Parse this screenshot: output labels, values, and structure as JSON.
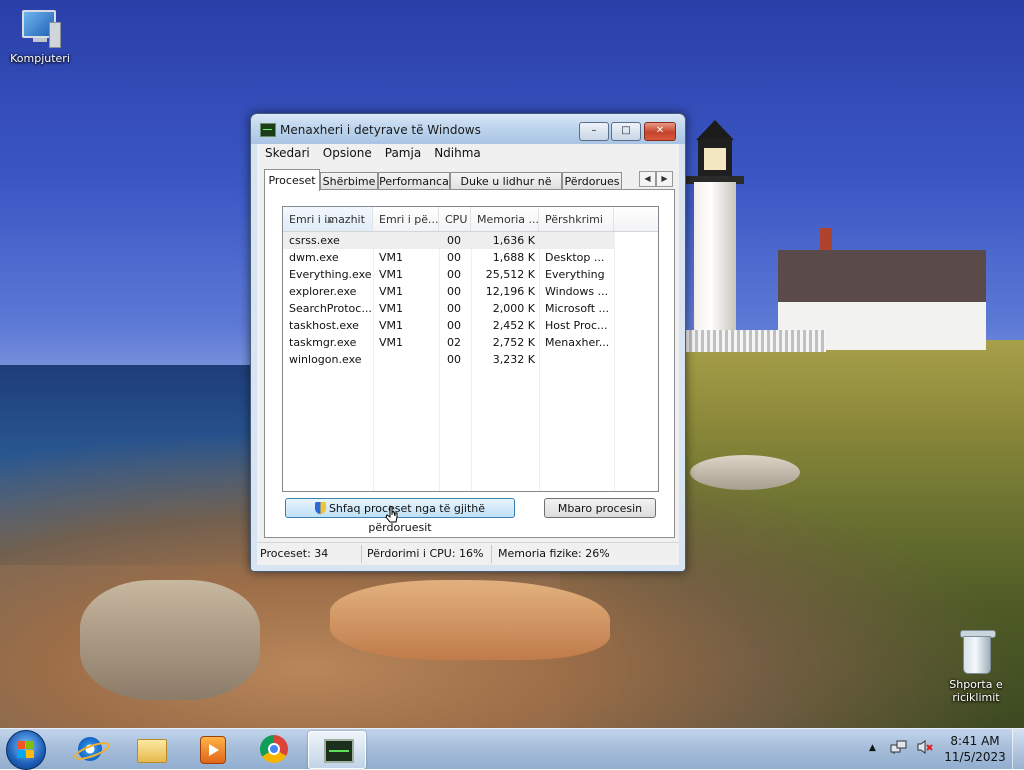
{
  "desktop": {
    "icons": [
      {
        "label": "Kompjuteri",
        "icon": "computer-icon"
      },
      {
        "label": "Shporta e riciklimit",
        "icon": "recycle-bin-icon"
      }
    ]
  },
  "window": {
    "title": "Menaxheri i detyrave të Windows",
    "menu": [
      "Skedari",
      "Opsione",
      "Pamja",
      "Ndihma"
    ],
    "tabs": [
      "Proceset",
      "Shërbime",
      "Performanca",
      "Duke u lidhur në rrjet",
      "Përdorues"
    ],
    "active_tab": "Proceset",
    "columns": [
      "Emri i imazhit",
      "Emri i pë...",
      "CPU",
      "Memoria ...",
      "Përshkrimi"
    ],
    "processes": [
      {
        "name": "csrss.exe",
        "user": "",
        "cpu": "00",
        "memory": "1,636 K",
        "description": ""
      },
      {
        "name": "dwm.exe",
        "user": "VM1",
        "cpu": "00",
        "memory": "1,688 K",
        "description": "Desktop ..."
      },
      {
        "name": "Everything.exe",
        "user": "VM1",
        "cpu": "00",
        "memory": "25,512 K",
        "description": "Everything"
      },
      {
        "name": "explorer.exe",
        "user": "VM1",
        "cpu": "00",
        "memory": "12,196 K",
        "description": "Windows ..."
      },
      {
        "name": "SearchProtoc...",
        "user": "VM1",
        "cpu": "00",
        "memory": "2,000 K",
        "description": "Microsoft ..."
      },
      {
        "name": "taskhost.exe",
        "user": "VM1",
        "cpu": "00",
        "memory": "2,452 K",
        "description": "Host Proc..."
      },
      {
        "name": "taskmgr.exe",
        "user": "VM1",
        "cpu": "02",
        "memory": "2,752 K",
        "description": "Menaxher..."
      },
      {
        "name": "winlogon.exe",
        "user": "",
        "cpu": "00",
        "memory": "3,232 K",
        "description": ""
      }
    ],
    "buttons": {
      "show_all": "Shfaq proceset nga të gjithë përdoruesit",
      "end_process": "Mbaro procesin"
    },
    "status": {
      "processes": "Proceset: 34",
      "cpu": "Përdorimi i CPU: 16%",
      "memory": "Memoria fizike: 26%"
    }
  },
  "taskbar": {
    "pinned": [
      "internet-explorer-icon",
      "file-explorer-icon",
      "media-player-icon",
      "chrome-icon",
      "task-manager-icon"
    ],
    "clock_time": "8:41 AM",
    "clock_date": "11/5/2023"
  },
  "colors": {
    "selection_bar": "#eeeeee",
    "close_button": "#c5432a",
    "taskbar": "#a8c0dc"
  }
}
